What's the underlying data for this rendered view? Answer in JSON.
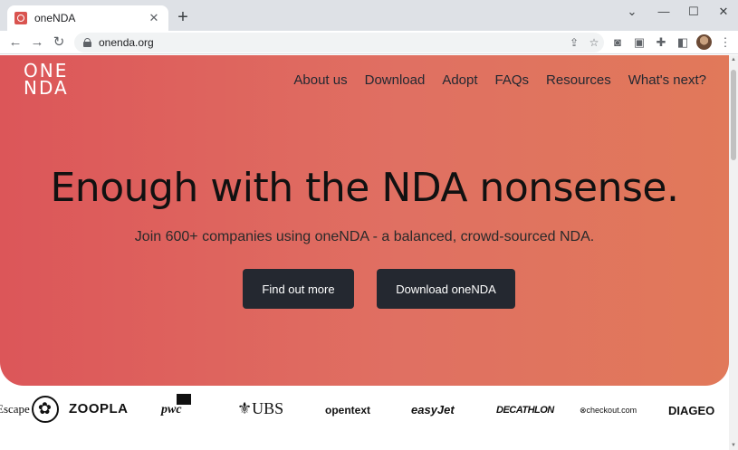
{
  "browser": {
    "tab_title": "oneNDA",
    "tab_close": "✕",
    "new_tab": "+",
    "url": "onenda.org",
    "window_controls": {
      "chevron": "⌄",
      "minimize": "—",
      "maximize": "☐",
      "close": "✕"
    }
  },
  "site": {
    "logo_line1": "ONE",
    "logo_line2": "NDA",
    "nav": [
      "About us",
      "Download",
      "Adopt",
      "FAQs",
      "Resources",
      "What's next?"
    ],
    "headline": "Enough with the NDA nonsense.",
    "subhead": "Join 600+ companies using oneNDA - a balanced, crowd-sourced NDA.",
    "cta_primary": "Find out more",
    "cta_secondary": "Download oneNDA",
    "logos": {
      "escape": "Escape",
      "zoopla": "ZOOPLA",
      "pwc": "pwc",
      "ubs": "UBS",
      "opentext": "opentext",
      "easyjet": "easyJet",
      "decathlon": "DECATHLON",
      "checkout": "checkout.com",
      "diageo": "DIAGEO"
    }
  },
  "colors": {
    "hero_start": "#dc5659",
    "hero_end": "#e1795a",
    "button_bg": "#242830"
  }
}
